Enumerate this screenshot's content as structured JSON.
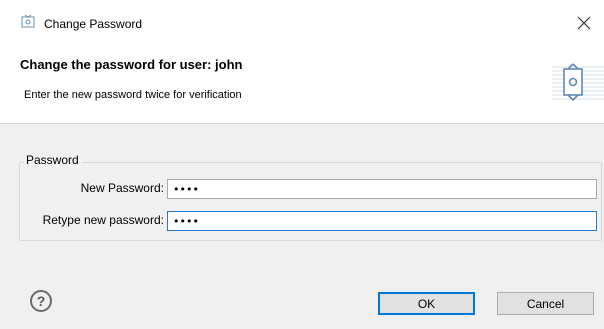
{
  "window": {
    "title": "Change Password",
    "close_glyph": "×",
    "icon": "password-dialog-icon"
  },
  "header": {
    "title": "Change the password for user: john",
    "subtitle": "Enter the new password twice for verification",
    "icon": "password-refresh-icon"
  },
  "password_group": {
    "legend": "Password",
    "new_password": {
      "label": "New Password:",
      "value": "abcd",
      "type": "password"
    },
    "retype_password": {
      "label": "Retype new password:",
      "value": "abcd",
      "type": "password",
      "focused": true
    }
  },
  "footer": {
    "help_glyph": "?",
    "ok_label": "OK",
    "cancel_label": "Cancel"
  },
  "colors": {
    "window_bg": "#f0f0f0",
    "header_bg": "#ffffff",
    "focus_border": "#2b78d4",
    "primary_button_border": "#0078d7"
  }
}
